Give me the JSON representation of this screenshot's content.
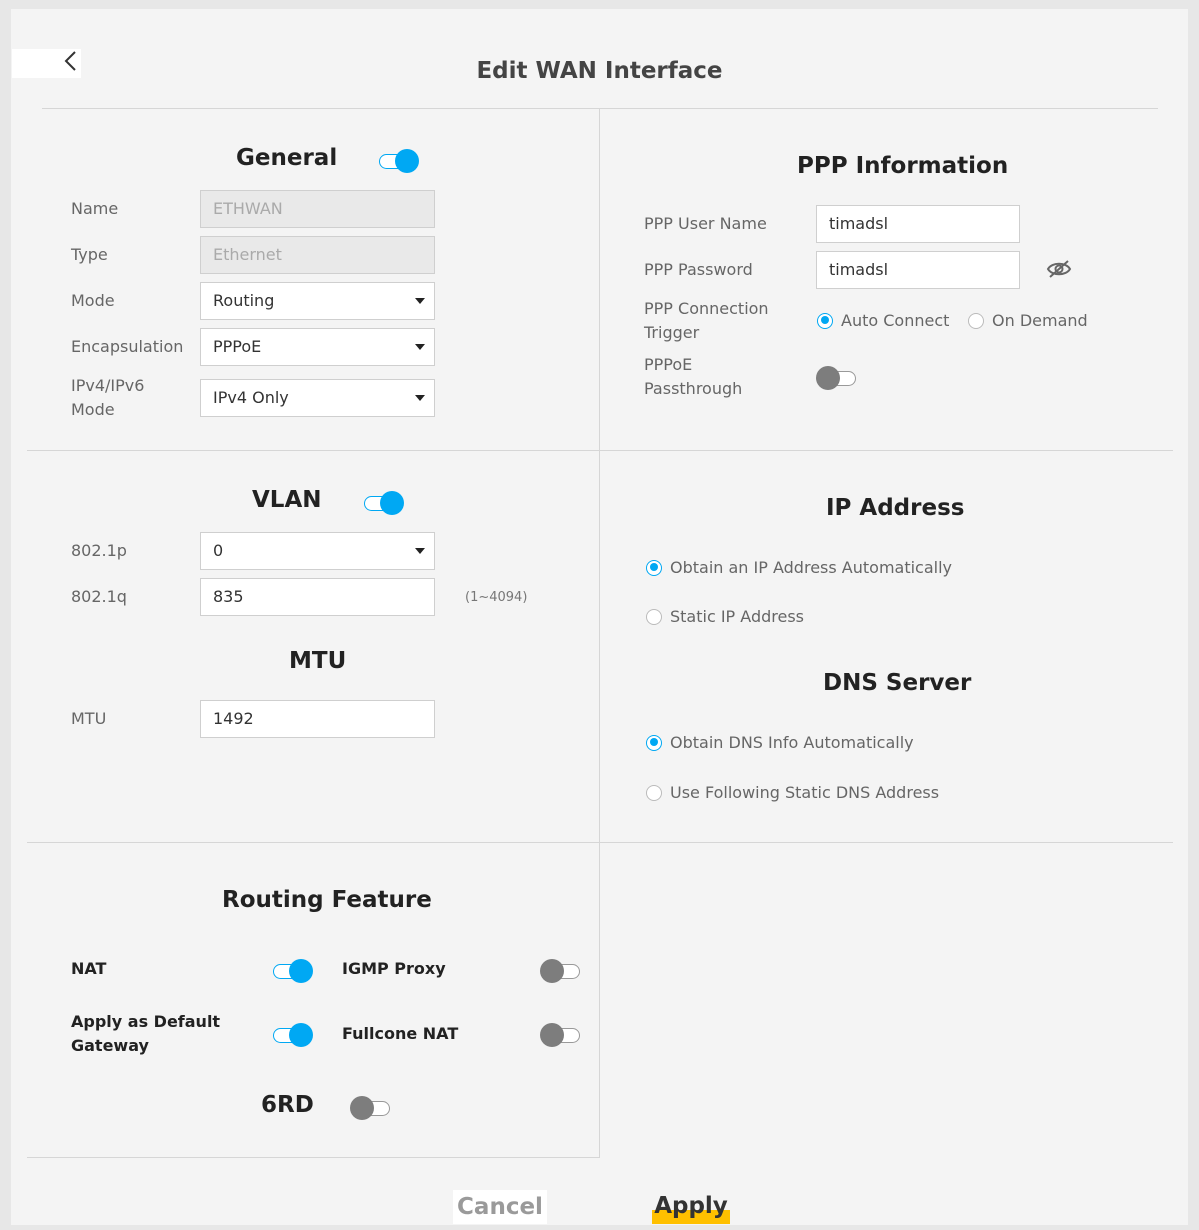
{
  "page": {
    "title": "Edit WAN Interface"
  },
  "general": {
    "title": "General",
    "enabled": true,
    "name_label": "Name",
    "name_value": "ETHWAN",
    "type_label": "Type",
    "type_value": "Ethernet",
    "mode_label": "Mode",
    "mode_value": "Routing",
    "encapsulation_label": "Encapsulation",
    "encapsulation_value": "PPPoE",
    "ipmode_label_line1": "IPv4/IPv6",
    "ipmode_label_line2": "Mode",
    "ipmode_value": "IPv4 Only"
  },
  "ppp": {
    "title": "PPP Information",
    "user_label": "PPP User Name",
    "user_value": "timadsl",
    "password_label": "PPP Password",
    "password_value": "timadsl",
    "trigger_label_line1": "PPP Connection",
    "trigger_label_line2": "Trigger",
    "trigger_options": [
      {
        "label": "Auto Connect",
        "checked": true
      },
      {
        "label": "On Demand",
        "checked": false
      }
    ],
    "passthrough_label_line1": "PPPoE",
    "passthrough_label_line2": "Passthrough",
    "passthrough_enabled": false
  },
  "vlan": {
    "title": "VLAN",
    "enabled": true,
    "p_label": "802.1p",
    "p_value": "0",
    "q_label": "802.1q",
    "q_value": "835",
    "q_hint": "(1~4094)"
  },
  "mtu": {
    "title": "MTU",
    "label": "MTU",
    "value": "1492"
  },
  "ip_address": {
    "title": "IP Address",
    "options": [
      {
        "label": "Obtain an IP Address Automatically",
        "checked": true
      },
      {
        "label": "Static IP Address",
        "checked": false
      }
    ]
  },
  "dns": {
    "title": "DNS Server",
    "options": [
      {
        "label": "Obtain DNS Info Automatically",
        "checked": true
      },
      {
        "label": "Use Following Static DNS Address",
        "checked": false
      }
    ]
  },
  "routing": {
    "title": "Routing Feature",
    "nat_label": "NAT",
    "nat_enabled": true,
    "igmp_label": "IGMP Proxy",
    "igmp_enabled": false,
    "gateway_label_line1": "Apply as Default",
    "gateway_label_line2": "Gateway",
    "gateway_enabled": true,
    "fullcone_label": "Fullcone NAT",
    "fullcone_enabled": false,
    "sixrd_label": "6RD",
    "sixrd_enabled": false
  },
  "actions": {
    "cancel_label": "Cancel",
    "apply_label": "Apply"
  },
  "colors": {
    "accent": "#00a8f3",
    "apply_highlight": "#ffc000"
  },
  "icons": {
    "back": "chevron-left-icon",
    "password_visibility": "eye-slash-icon"
  }
}
